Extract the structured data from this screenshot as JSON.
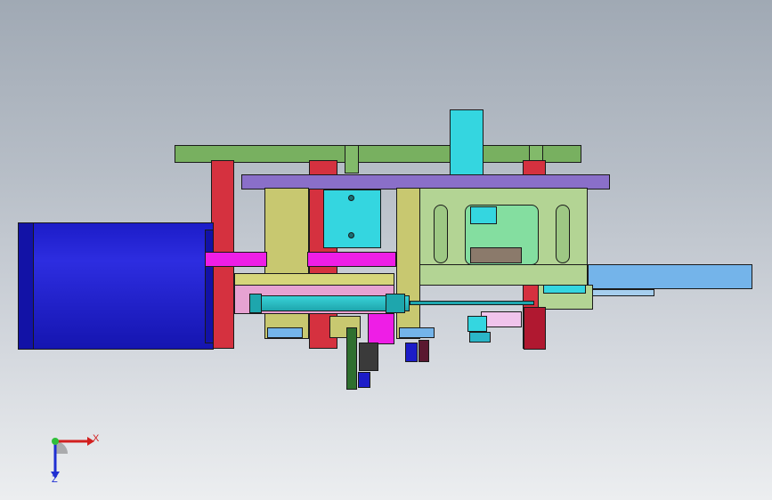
{
  "viewport": {
    "background_top": "#a0a9b4",
    "background_bottom": "#eceef0"
  },
  "triad": {
    "x_label": "X",
    "z_label": "Z",
    "x_color": "#d21f1f",
    "z_color": "#1f2fd2",
    "origin_color": "#2fbf3a"
  },
  "part_colors": {
    "motor": "#1c1cc8",
    "frame_green": "#78b060",
    "top_plate": "#8a6fc9",
    "cylinder_cyan": "#34d6e0",
    "red_block": "#d5313f",
    "yellow_plate": "#c8c870",
    "magenta": "#ee1ee6",
    "pink": "#e6a2d2",
    "bracket": "#b3d494",
    "mint": "#84dea0",
    "light_blue_bar": "#74b4ea",
    "dark_red": "#b01830",
    "teal_rod": "#1ea6ad"
  }
}
